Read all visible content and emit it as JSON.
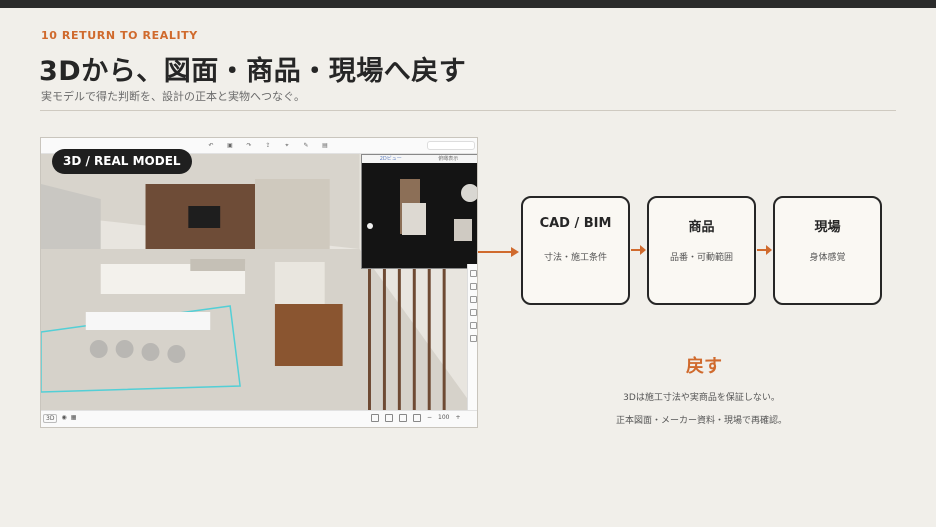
{
  "slide": {
    "eyebrow": "10  RETURN TO REALITY",
    "title": "3Dから、図面・商品・現場へ戻す",
    "subtitle": "実モデルで得た判断を、設計の正本と実物へつなぐ。"
  },
  "screenshot": {
    "badge": "3D / REAL MODEL",
    "toolbar_icons": [
      "undo-icon",
      "save-icon",
      "redo-icon",
      "share-icon",
      "measure-icon",
      "tool-icon",
      "album-icon"
    ],
    "map_tabs": [
      "2Dビュー",
      "俯瞰表示"
    ],
    "bottom_view_mode": "3D",
    "zoom_value": "100"
  },
  "flow": {
    "boxes": [
      {
        "title": "CAD / BIM",
        "sub": "寸法・施工条件"
      },
      {
        "title": "商品",
        "sub": "品番・可動範囲"
      },
      {
        "title": "現場",
        "sub": "身体感覚"
      }
    ]
  },
  "return": {
    "title": "戻す",
    "line1": "3Dは施工寸法や実商品を保証しない。",
    "line2": "正本図面・メーカー資料・現場で再確認。"
  },
  "colors": {
    "accent": "#d06a2d",
    "dark": "#262626",
    "background": "#f1efea"
  }
}
